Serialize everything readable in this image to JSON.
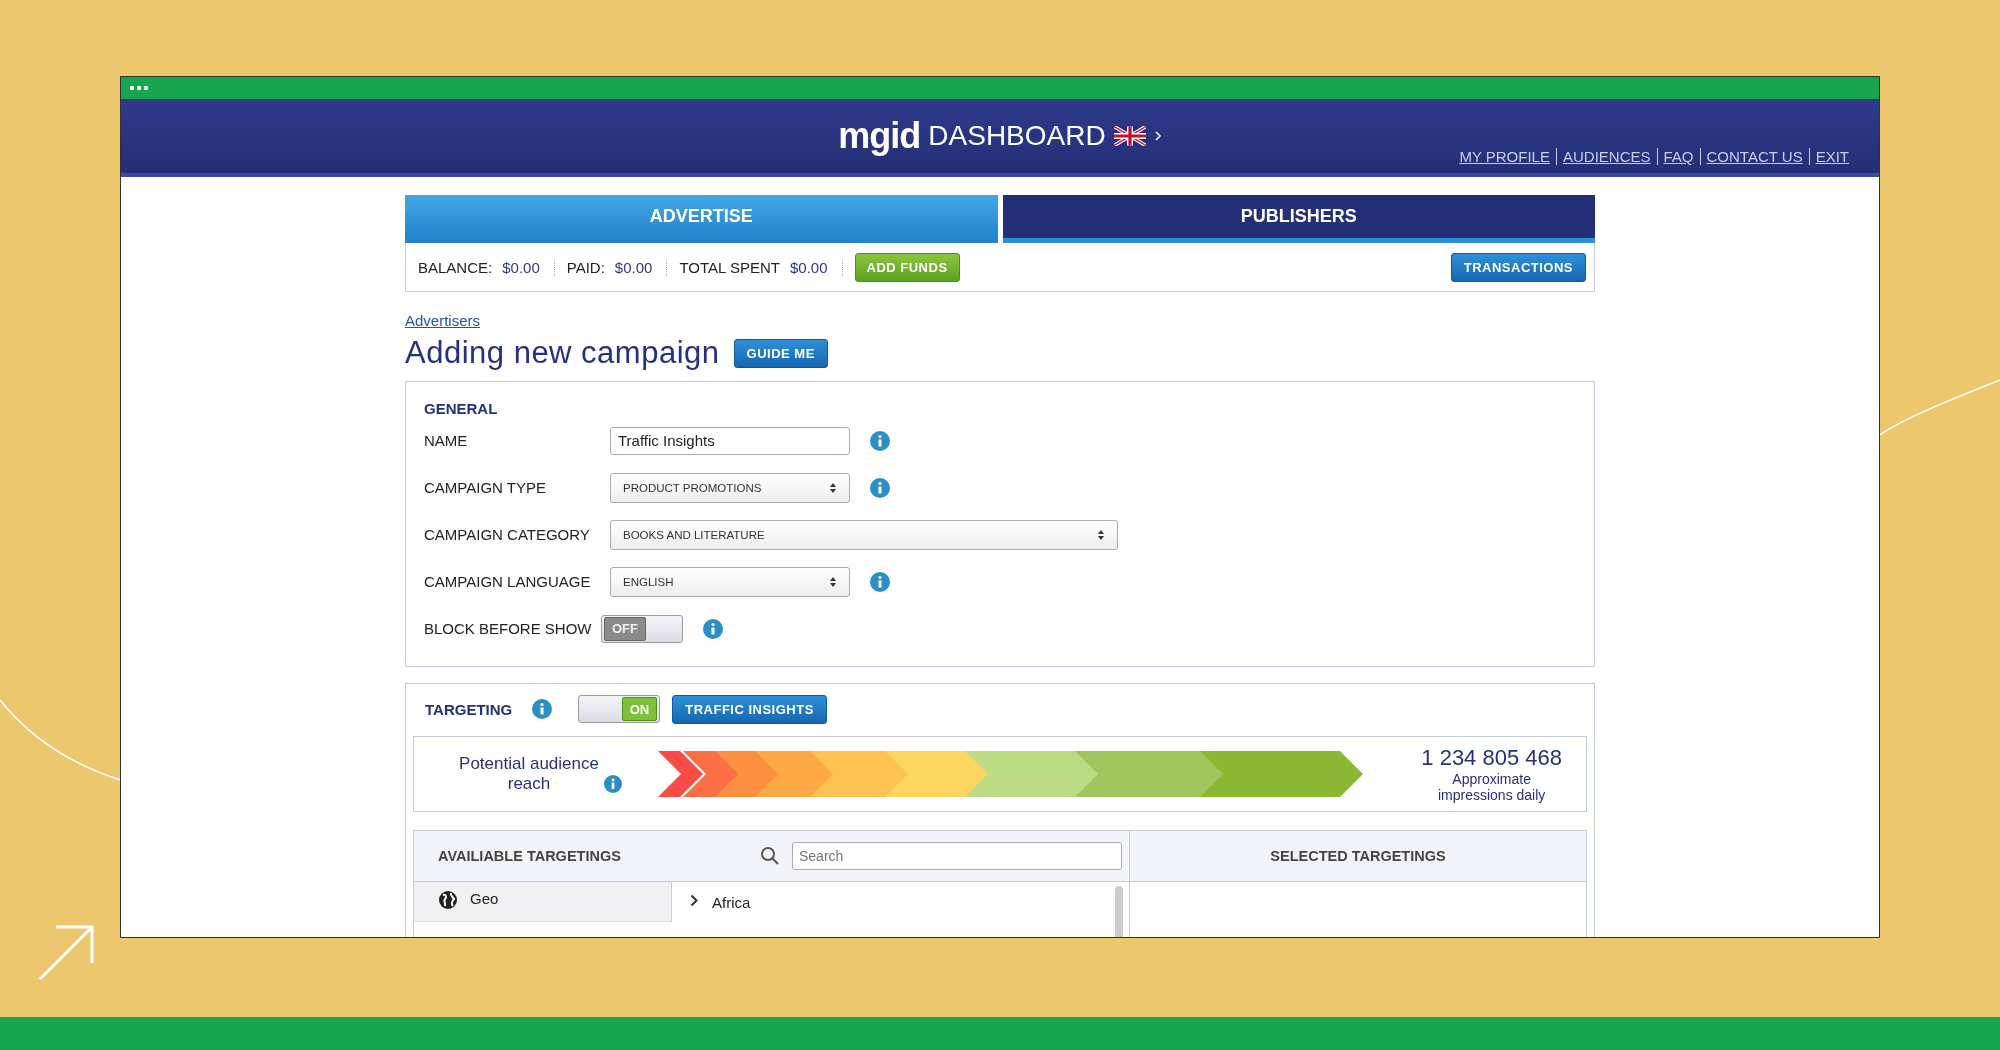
{
  "header": {
    "logo": "mgid",
    "logo_suffix": "DASHBOARD",
    "nav": [
      "MY PROFILE",
      "AUDIENCES",
      "FAQ",
      "CONTACT US",
      "EXIT"
    ]
  },
  "tabs": [
    {
      "label": "ADVERTISE",
      "selected": true
    },
    {
      "label": "PUBLISHERS",
      "selected": false
    }
  ],
  "balance": [
    {
      "label": "BALANCE:",
      "value": "$0.00"
    },
    {
      "label": "PAID:",
      "value": "$0.00"
    },
    {
      "label": "TOTAL SPENT",
      "value": "$0.00"
    }
  ],
  "add_funds": "ADD FUNDS",
  "transactions": "TRANSACTIONS",
  "breadcrumb": "Advertisers",
  "title": "Adding new campaign",
  "guide": "GUIDE ME",
  "general": {
    "heading": "GENERAL",
    "fields": [
      {
        "kind": "text",
        "label": "NAME",
        "value": "Traffic Insights",
        "info": true
      },
      {
        "kind": "select",
        "label": "CAMPAIGN TYPE",
        "value": "PRODUCT PROMOTIONS",
        "info": true,
        "wide": false
      },
      {
        "kind": "select",
        "label": "CAMPAIGN CATEGORY",
        "value": "BOOKS AND LITERATURE",
        "info": false,
        "wide": true
      },
      {
        "kind": "select",
        "label": "CAMPAIGN LANGUAGE",
        "value": "ENGLISH",
        "info": true,
        "wide": false
      },
      {
        "kind": "toggle",
        "label": "BLOCK BEFORE SHOW",
        "on": false,
        "value": "OFF",
        "info": true
      }
    ]
  },
  "targeting": {
    "heading": "TARGETING",
    "toggle": {
      "on": true,
      "value": "ON"
    },
    "button": "TRAFFIC INSIGHTS",
    "reach": {
      "label": "Potential audience reach",
      "count": "1 234 805 468",
      "caption": "Approximate impressions daily"
    },
    "available": "AVAILIABLE TARGETINGS",
    "search_placeholder": "Search",
    "selected_heading": "SELECTED TARGETINGS",
    "categories": [
      {
        "label": "Geo"
      }
    ],
    "items": [
      {
        "label": "Africa",
        "expanded": false
      }
    ]
  }
}
